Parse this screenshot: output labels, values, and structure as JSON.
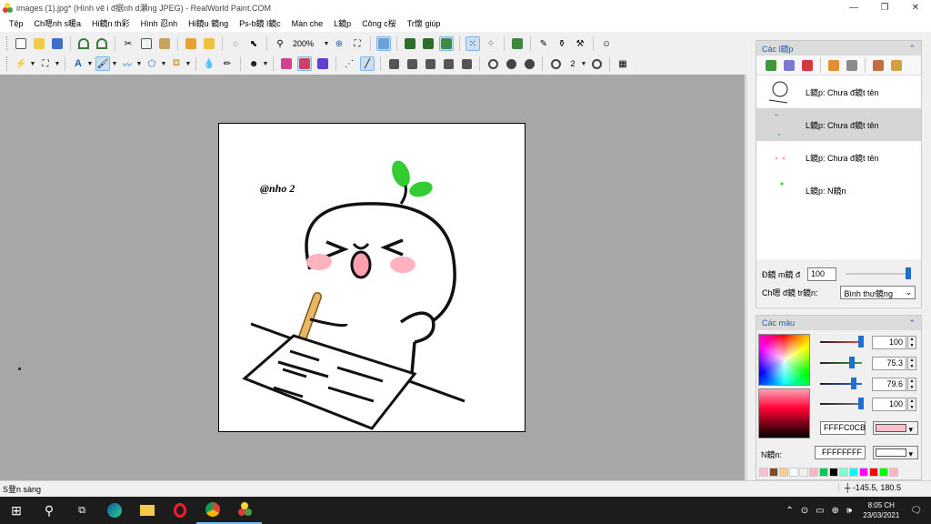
{
  "window": {
    "title": "images (1).jpg* (Hình vẽ i đ据nh d瀬ng JPEG) - RealWorld Paint.COM",
    "minimize": "—",
    "maximize": "❐",
    "close": "✕"
  },
  "menu": [
    "Tệp",
    "Ch嗯nh s暖a",
    "Hi鏡n th彩",
    "Hình 忍nh",
    "Hi鏡u 鏡ng",
    "Ps-b鏡 l鏡c",
    "Màn che",
    "L鏡p",
    "Công c桜",
    "Tr懷 giúp"
  ],
  "toolbar": {
    "zoom": "200%",
    "brush_size": "2"
  },
  "canvas": {
    "watermark": "@nho 2",
    "colors": {
      "sprout": "#33cc33",
      "pencil": "#e8b864",
      "cheek": "#ffb3c1",
      "mouth": "#ff9fb0"
    }
  },
  "layers_panel": {
    "title": "Các l鏡p",
    "layers": [
      {
        "name": "L鏡p: Chưa đ鏡t tên",
        "selected": false
      },
      {
        "name": "L鏡p: Chưa đ鏡t tên",
        "selected": true
      },
      {
        "name": "L鏡p: Chưa đ鏡t tên",
        "selected": false
      },
      {
        "name": "L鏡p: N鏡n",
        "selected": false
      }
    ],
    "opacity_label": "Đ鏡 m鏡 đ",
    "opacity_value": "100",
    "blend_label": "Ch嗯 đ鏡 tr鏡n:",
    "blend_value": "Bình thư鏡ng"
  },
  "colors_panel": {
    "title": "Các màu",
    "channels": [
      {
        "value": "100",
        "color": "#ff4040",
        "level": 0.98
      },
      {
        "value": "75.3",
        "color": "#30b030",
        "level": 0.75
      },
      {
        "value": "79.6",
        "color": "#3060ff",
        "level": 0.8
      },
      {
        "value": "100",
        "color": "#777777",
        "level": 0.98
      }
    ],
    "primary_hex": "FFFFC0CB",
    "primary_color": "#ffc0cb",
    "background_label": "N鏡n:",
    "background_hex": "FFFFFFFF",
    "background_color": "#ffffff",
    "palette": [
      "#ffc0cb",
      "#7a4a2a",
      "#f5d08a",
      "#ffffff",
      "#f0f0f0",
      "#ffb6c1",
      "#00c853",
      "#000000",
      "#7fffd4",
      "#00ffff",
      "#ff00ff",
      "#ff0000",
      "#00ff00",
      "#ffb6c1"
    ]
  },
  "status": {
    "text": "S登n sàng",
    "coords": "-145.5, 180.5"
  },
  "taskbar": {
    "time": "8:05 CH",
    "date": "23/03/2021"
  }
}
